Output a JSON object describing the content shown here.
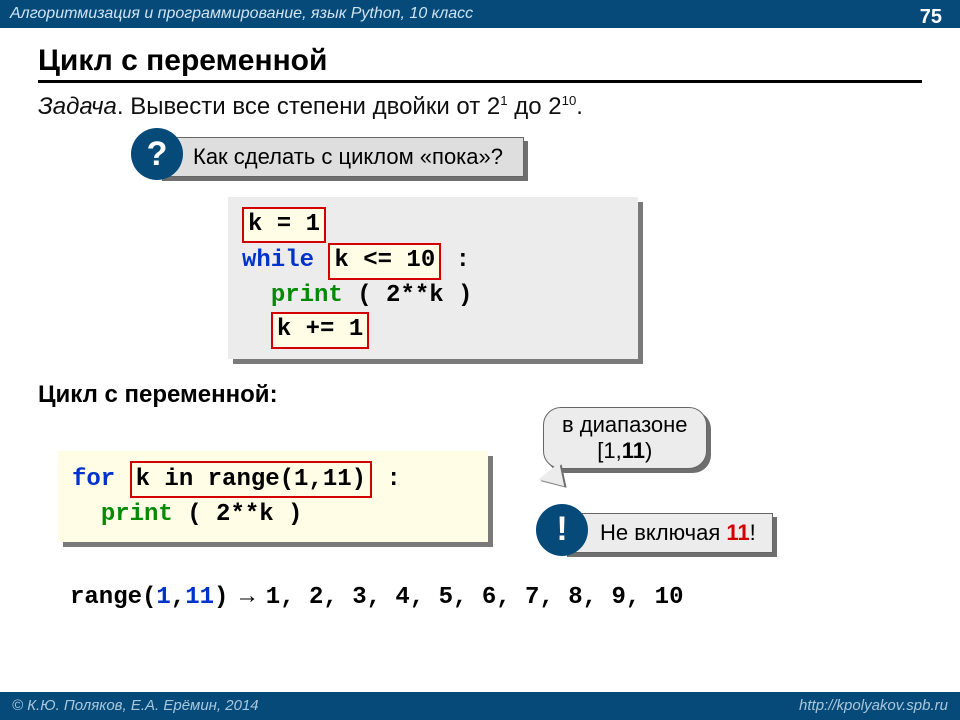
{
  "header": {
    "course": "Алгоритмизация и программирование, язык Python, 10 класс",
    "page": "75"
  },
  "title": "Цикл с переменной",
  "task_label": "Задача",
  "task_text": ". Вывести все степени двойки от 2",
  "task_sup1": "1",
  "task_mid": " до 2",
  "task_sup2": "10",
  "task_end": ".",
  "hint_q": {
    "badge": "?",
    "text": "Как сделать с циклом «пока»?"
  },
  "code_while": {
    "l1_hl": "k = 1",
    "l2_kw": "while",
    "l2_hl": "k <= 10",
    "l2_end": ":",
    "l3_kw": "print",
    "l3_rest": "( 2**k )",
    "l4_hl": "k += 1"
  },
  "subhead": "Цикл с переменной:",
  "code_for": {
    "kw": "for",
    "hl": "k in range(1,11)",
    "end": ":",
    "l2_kw": "print",
    "l2_rest": "( 2**k )"
  },
  "callout_range": {
    "line1": "в диапазоне",
    "line2a": "[1,",
    "line2b": "11",
    "line2c": ")"
  },
  "excl": {
    "badge": "!",
    "pre": "Не включая ",
    "num": "11",
    "post": "!"
  },
  "range_line": {
    "call_pre": "range(",
    "arg1": "1",
    "sep": ",",
    "arg2": "11",
    "call_post": ")",
    "arrow": " → ",
    "seq": "1, 2, 3, 4, 5, 6, 7, 8, 9, 10"
  },
  "footer": {
    "left": "© К.Ю. Поляков, Е.А. Ерёмин, 2014",
    "right": "http://kpolyakov.spb.ru"
  }
}
